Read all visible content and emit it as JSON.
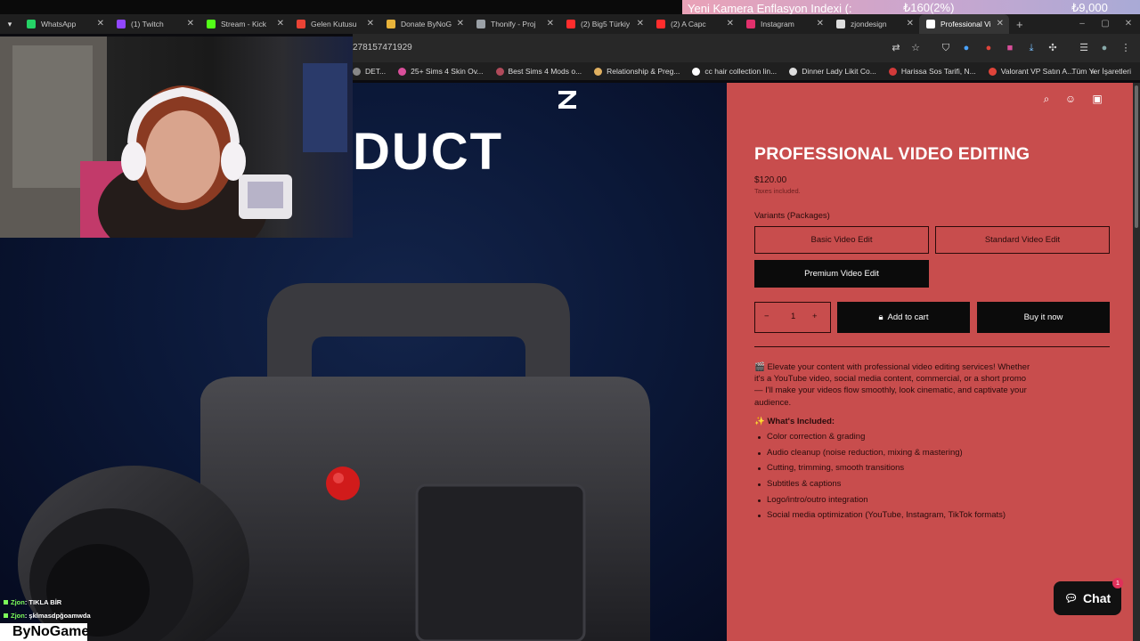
{
  "ticker": {
    "text": "Yeni Kamera Enflasyon Indexi (:",
    "value": "₺160(2%)",
    "price": "₺9,000"
  },
  "tabs": [
    {
      "label": "WhatsApp",
      "color": "#25d366"
    },
    {
      "label": "(1) Twitch",
      "color": "#9146ff"
    },
    {
      "label": "Stream - Kick",
      "color": "#53fc18"
    },
    {
      "label": "Gelen Kutusu",
      "color": "#ea4335"
    },
    {
      "label": "Donate ByNoG",
      "color": "#e8b33a"
    },
    {
      "label": "Thonify - Proj",
      "color": "#9aa0a6"
    },
    {
      "label": "(2) Big5 Türkiy",
      "color": "#ff2d2d"
    },
    {
      "label": "(2) A Capc",
      "color": "#ff2d2d"
    },
    {
      "label": "Instagram",
      "color": "#e1306c"
    },
    {
      "label": "zjondesign",
      "color": "#dddddd"
    },
    {
      "label": "Professional Vi",
      "color": "#ffffff"
    }
  ],
  "address": {
    "url": "278157471929"
  },
  "bookmarks": [
    {
      "label": "DET...",
      "color": "#888888"
    },
    {
      "label": "25+ Sims 4 Skin Ov...",
      "color": "#d94f9a"
    },
    {
      "label": "Best Sims 4 Mods o...",
      "color": "#b04a5a"
    },
    {
      "label": "Relationship & Preg...",
      "color": "#e0b060"
    },
    {
      "label": "cc hair collection lin...",
      "color": "#ffffff"
    },
    {
      "label": "Dinner Lady Likit Co...",
      "color": "#dddddd"
    },
    {
      "label": "Harissa Sos Tarifi, N...",
      "color": "#d23a3a"
    },
    {
      "label": "Valorant VP Satın A...",
      "color": "#e0443a"
    }
  ],
  "bookmarks_all": "Tüm Yer İşaretleri",
  "hero": {
    "title": "DUCT"
  },
  "product": {
    "title": "PROFESSIONAL VIDEO EDITING",
    "price": "$120.00",
    "tax": "Taxes included.",
    "variants_label": "Variants (Packages)",
    "variants": [
      "Basic Video Edit",
      "Standard Video Edit",
      "Premium Video Edit"
    ],
    "selected_variant": "Premium Video Edit",
    "quantity": "1",
    "add_to_cart": "Add to cart",
    "buy_now": "Buy it now",
    "description": "🎬 Elevate your content with professional video editing services! Whether it's a YouTube video, social media content, commercial, or a short promo — I'll make your videos flow smoothly, look cinematic, and captivate your audience.",
    "included_title": "✨ What's Included:",
    "included": [
      "Color correction & grading",
      "Audio cleanup (noise reduction, mixing & mastering)",
      "Cutting, trimming, smooth transitions",
      "Subtitles & captions",
      "Logo/intro/outro integration",
      "Social media optimization (YouTube, Instagram, TikTok formats)"
    ]
  },
  "chat_widget": {
    "label": "Chat",
    "badge": "1"
  },
  "stream_chat": [
    {
      "name": "Zjon",
      "message": "TIKLA BİR"
    },
    {
      "name": "Zjon",
      "message": "şklmasdpğoamwda"
    }
  ],
  "brand": "ByNoGame",
  "colors": {
    "panel": "#c84d4d",
    "hero": "#0b1838"
  }
}
